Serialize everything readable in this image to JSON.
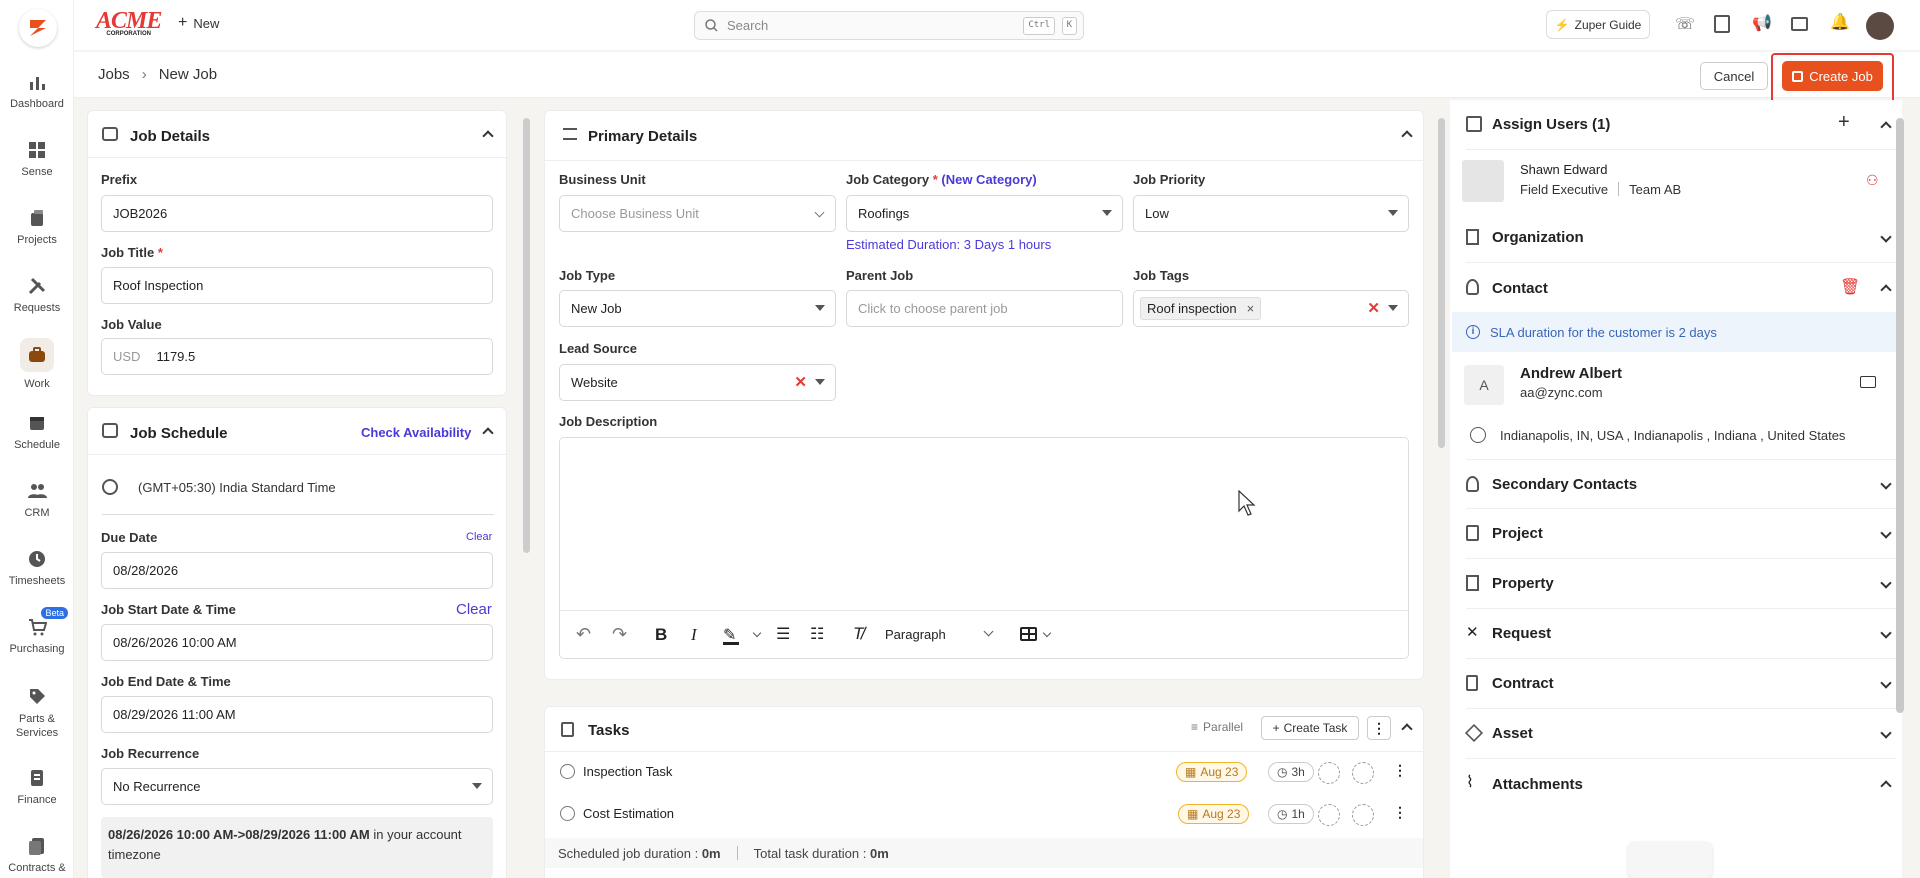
{
  "app": {
    "logo": "ACME",
    "logo_sub": "CORPORATION",
    "new_label": "New"
  },
  "search": {
    "placeholder": "Search",
    "kbd1": "Ctrl",
    "kbd2": "K"
  },
  "topbar": {
    "guide_label": "Zuper Guide"
  },
  "nav": [
    {
      "label": "Dashboard",
      "icon": "bar-chart-icon"
    },
    {
      "label": "Sense",
      "icon": "grid-icon"
    },
    {
      "label": "Projects",
      "icon": "projects-icon"
    },
    {
      "label": "Requests",
      "icon": "tools-icon"
    },
    {
      "label": "Work",
      "icon": "briefcase-icon"
    },
    {
      "label": "Schedule",
      "icon": "calendar-icon"
    },
    {
      "label": "CRM",
      "icon": "people-icon"
    },
    {
      "label": "Timesheets",
      "icon": "clock-icon"
    },
    {
      "label": "Purchasing",
      "icon": "cart-icon",
      "badge": "Beta"
    },
    {
      "label": "Parts & Services",
      "icon": "tag-icon"
    },
    {
      "label": "Finance",
      "icon": "finance-icon"
    },
    {
      "label": "Contracts &",
      "icon": "contracts-icon"
    }
  ],
  "breadcrumb": {
    "root": "Jobs",
    "current": "New Job"
  },
  "actions": {
    "cancel": "Cancel",
    "create": "Create Job"
  },
  "job_details": {
    "title": "Job Details",
    "prefix_label": "Prefix",
    "prefix_value": "JOB2026",
    "title_label": "Job Title",
    "title_value": "Roof Inspection",
    "required": "*",
    "value_label": "Job Value",
    "currency": "USD",
    "value": "1179.5"
  },
  "schedule": {
    "title": "Job Schedule",
    "check": "Check Availability",
    "timezone": "(GMT+05:30) India Standard Time",
    "due_label": "Due Date",
    "clear": "Clear",
    "due_value": "08/28/2026",
    "start_label": "Job Start Date & Time",
    "start_value": "08/26/2026 10:00 AM",
    "end_label": "Job End Date & Time",
    "end_value": "08/29/2026 11:00 AM",
    "recurrence_label": "Job Recurrence",
    "recurrence_value": "No Recurrence",
    "summary_bold": "08/26/2026 10:00 AM->08/29/2026 11:00 AM",
    "summary_rest": " in your account timezone"
  },
  "primary": {
    "title": "Primary Details",
    "bu_label": "Business Unit",
    "bu_placeholder": "Choose Business Unit",
    "cat_label": "Job Category",
    "cat_required": "*",
    "cat_new": "(New Category)",
    "cat_value": "Roofings",
    "estimated": "Estimated Duration: 3 Days 1 hours",
    "priority_label": "Job Priority",
    "priority_value": "Low",
    "type_label": "Job Type",
    "type_value": "New Job",
    "parent_label": "Parent Job",
    "parent_placeholder": "Click to choose parent job",
    "tags_label": "Job Tags",
    "tag": "Roof inspection",
    "lead_label": "Lead Source",
    "lead_value": "Website",
    "desc_label": "Job Description",
    "paragraph": "Paragraph"
  },
  "tasks": {
    "title": "Tasks",
    "parallel": "Parallel",
    "create": "Create Task",
    "items": [
      {
        "name": "Inspection Task",
        "date": "Aug 23",
        "dur": "3h"
      },
      {
        "name": "Cost Estimation",
        "date": "Aug 23",
        "dur": "1h"
      }
    ],
    "footer1": "Scheduled job duration : ",
    "footer1_val": "0m",
    "footer2": "Total task duration : ",
    "footer2_val": "0m"
  },
  "right": {
    "assign": "Assign Users (1)",
    "user_name": "Shawn Edward",
    "user_role": "Field Executive",
    "user_team": "Team AB",
    "organization": "Organization",
    "contact": "Contact",
    "sla": "SLA duration for the customer is 2 days",
    "contact_initial": "A",
    "contact_name": "Andrew Albert",
    "contact_email": "aa@zync.com",
    "address": "Indianapolis, IN, USA , Indianapolis , Indiana , United States",
    "secondary": "Secondary Contacts",
    "project": "Project",
    "property": "Property",
    "request": "Request",
    "contract": "Contract",
    "asset": "Asset",
    "attachments": "Attachments"
  },
  "colors": {
    "accent": "#e8501e",
    "link": "#4a3ad6",
    "highlight": "#e53935"
  }
}
